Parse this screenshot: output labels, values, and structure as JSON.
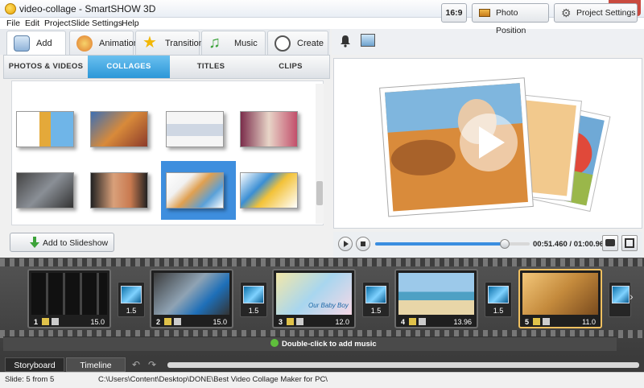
{
  "window": {
    "title": "video-collage - SmartSHOW 3D"
  },
  "menu": [
    "File",
    "Edit",
    "Project",
    "Slide",
    "Settings",
    "Help"
  ],
  "top_tabs": [
    {
      "label": "Add",
      "icon": "add-media-icon",
      "active": true
    },
    {
      "label": "Animation",
      "icon": "palette-icon"
    },
    {
      "label": "Transitions",
      "icon": "star-icon"
    },
    {
      "label": "Music",
      "icon": "music-note-icon"
    },
    {
      "label": "Create",
      "icon": "film-reel-icon"
    }
  ],
  "sub_tabs": [
    {
      "label": "PHOTOS & VIDEOS"
    },
    {
      "label": "COLLAGES",
      "active": true
    },
    {
      "label": "TITLES"
    },
    {
      "label": "CLIPS"
    }
  ],
  "add_to_slideshow": "Add to Slideshow",
  "toolbar": {
    "aspect": "16:9",
    "photo_position": "Photo Position",
    "project_settings": "Project Settings"
  },
  "player": {
    "time": "00:51.460 / 01:00.960",
    "progress": 0.84
  },
  "slides": [
    {
      "num": "1",
      "duration": "15.0"
    },
    {
      "num": "2",
      "duration": "15.0"
    },
    {
      "num": "3",
      "duration": "12.0"
    },
    {
      "num": "4",
      "duration": "13.96"
    },
    {
      "num": "5",
      "duration": "11.0"
    }
  ],
  "transitions": [
    "1.5",
    "1.5",
    "1.5",
    "1.5"
  ],
  "slide3_caption": "Our Baby Boy",
  "music_hint": "Double-click to add music",
  "bottom_tabs": [
    {
      "label": "Storyboard",
      "active": true
    },
    {
      "label": "Timeline"
    }
  ],
  "status": {
    "slide": "Slide: 5 from 5",
    "path": "C:\\Users\\Content\\Desktop\\DONE\\Best Video Collage Maker for PC\\"
  },
  "colors": {
    "accent": "#2c97d8",
    "selection": "#3e8ede"
  }
}
